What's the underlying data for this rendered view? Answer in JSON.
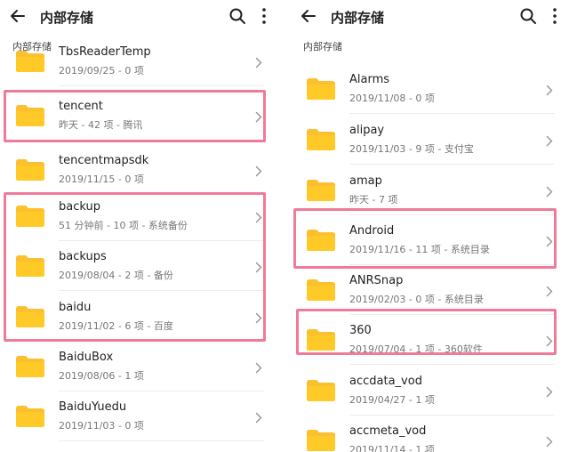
{
  "left": {
    "title": "内部存储",
    "breadcrumb": "内部存储",
    "items": [
      {
        "name": "TbsReaderTemp",
        "meta": "2019/09/25 - 0 项"
      },
      {
        "name": "tencent",
        "meta": "昨天 - 42 项 - 腾讯"
      },
      {
        "name": "tencentmapsdk",
        "meta": "2019/11/15 - 0 项"
      },
      {
        "name": "backup",
        "meta": "51 分钟前 - 10 项 - 系统备份"
      },
      {
        "name": "backups",
        "meta": "2019/08/04 - 2 项 - 备份"
      },
      {
        "name": "baidu",
        "meta": "2019/11/02 - 6 项 - 百度"
      },
      {
        "name": "BaiduBox",
        "meta": "2019/08/06 - 1 项"
      },
      {
        "name": "BaiduYuedu",
        "meta": "2019/11/03 - 0 项"
      }
    ]
  },
  "right": {
    "title": "内部存储",
    "breadcrumb": "内部存储",
    "items": [
      {
        "name": "Alarms",
        "meta": "2019/11/08 - 0 项"
      },
      {
        "name": "alipay",
        "meta": "2019/11/03 - 9 项 - 支付宝"
      },
      {
        "name": "amap",
        "meta": "昨天 - 7 项"
      },
      {
        "name": "Android",
        "meta": "2019/11/16 - 11 项 - 系统目录"
      },
      {
        "name": "ANRSnap",
        "meta": "2019/02/03 - 0 项 - 系统目录"
      },
      {
        "name": "360",
        "meta": "2019/07/04 - 1 项 - 360软件"
      },
      {
        "name": "accdata_vod",
        "meta": "2019/04/27 - 1 项"
      },
      {
        "name": "accmeta_vod",
        "meta": "2019/11/14 - 1 项"
      }
    ]
  },
  "icons": {
    "back": "arrow-back-icon",
    "search": "search-icon",
    "more": "more-vert-icon",
    "folder": "folder-icon",
    "chevron": "chevron-right-icon"
  },
  "colors": {
    "folder": "#FBC02D",
    "highlight": "#EF7A9A",
    "text": "#222222",
    "meta": "#777777"
  }
}
